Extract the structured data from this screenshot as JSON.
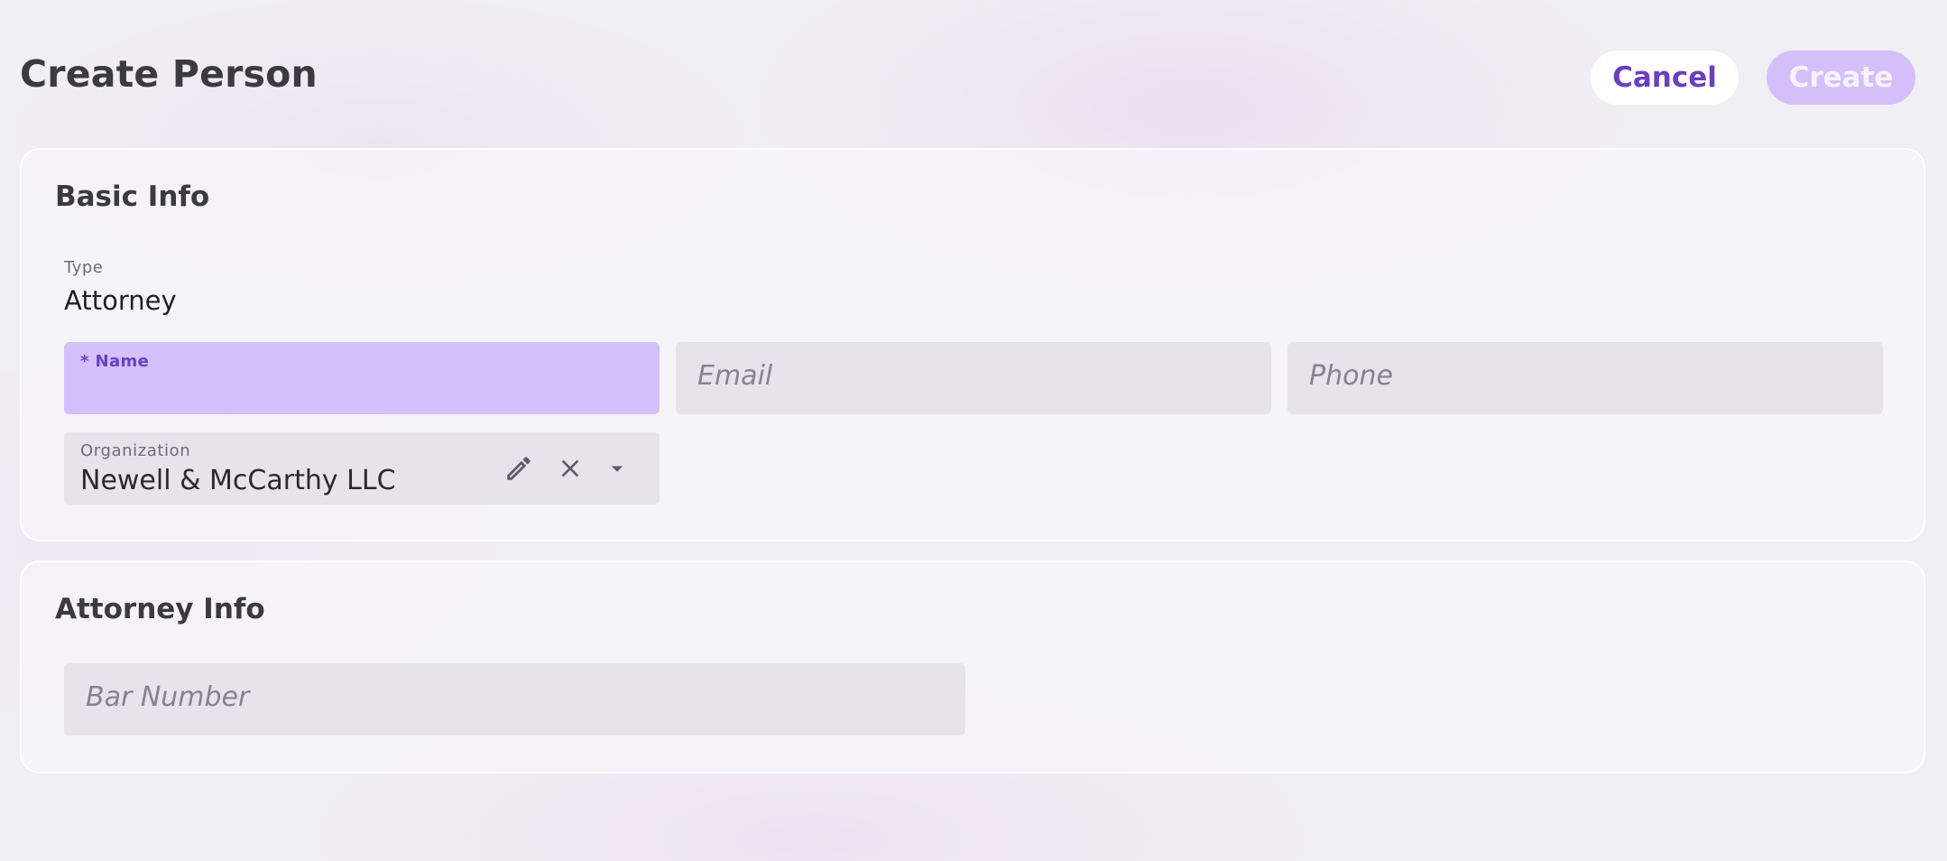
{
  "page": {
    "title": "Create Person"
  },
  "header": {
    "cancel_label": "Cancel",
    "create_label": "Create"
  },
  "basic_info": {
    "title": "Basic Info",
    "type_label": "Type",
    "type_value": "Attorney",
    "name_label": "* Name",
    "name_value": "",
    "email_placeholder": "Email",
    "phone_placeholder": "Phone",
    "organization_label": "Organization",
    "organization_value": "Newell & McCarthy LLC"
  },
  "attorney_info": {
    "title": "Attorney Info",
    "bar_number_placeholder": "Bar Number"
  },
  "icons": {
    "edit": "pencil-icon",
    "clear": "close-icon",
    "dropdown": "caret-down-icon"
  },
  "colors": {
    "accent": "#6a3fc0",
    "create_button_disabled": "#d4bffa",
    "name_field_active": "#d3c0fc",
    "field_background": "#e6e4ea"
  }
}
